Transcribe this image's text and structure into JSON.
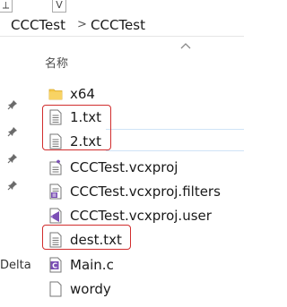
{
  "address_bar": {
    "crumbs": [
      "CCCTest",
      "CCCTest"
    ],
    "separator": ">",
    "tab_glyph_left": "⟂",
    "tab_glyph_right": "V"
  },
  "nav": {
    "truncated_label": "Delta"
  },
  "list": {
    "column_header": "名称",
    "items": [
      {
        "name": "x64",
        "icon": "folder-icon"
      },
      {
        "name": "1.txt",
        "icon": "text-file-icon"
      },
      {
        "name": "2.txt",
        "icon": "text-file-icon"
      },
      {
        "name": "CCCTest.vcxproj",
        "icon": "vcxproj-file-icon"
      },
      {
        "name": "CCCTest.vcxproj.filters",
        "icon": "filters-file-icon"
      },
      {
        "name": "CCCTest.vcxproj.user",
        "icon": "vs-user-file-icon"
      },
      {
        "name": "dest.txt",
        "icon": "text-file-icon"
      },
      {
        "name": "Main.c",
        "icon": "c-source-file-icon"
      },
      {
        "name": "wordy",
        "icon": "blank-file-icon"
      }
    ]
  },
  "colors": {
    "highlight": "#d12d2d",
    "folder": "#f6c94a",
    "vs_purple": "#7b4fb5"
  }
}
